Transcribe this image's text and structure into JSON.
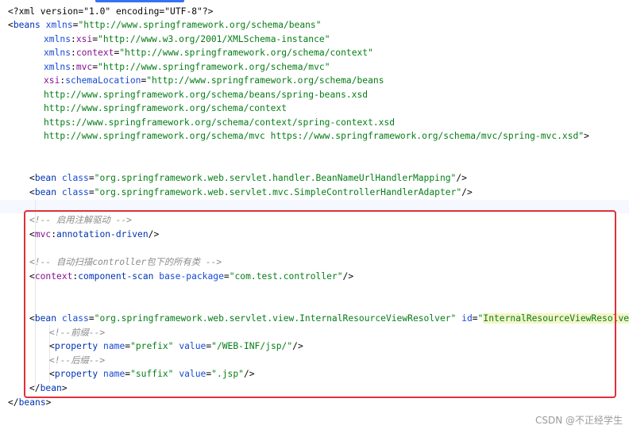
{
  "xml_decl": "<?xml version=\"1.0\" encoding=\"UTF-8\"?>",
  "lines": [
    {
      "parts": [
        [
          "punct",
          "<"
        ],
        [
          "tag",
          "beans"
        ],
        [
          "punct",
          " "
        ],
        [
          "attr",
          "xmlns"
        ],
        [
          "punct",
          "="
        ],
        [
          "val",
          "\"http://www.springframework.org/schema/beans\""
        ]
      ]
    },
    {
      "parts": [
        [
          "attr",
          "xmlns"
        ],
        [
          "punct",
          ":"
        ],
        [
          "ns",
          "xsi"
        ],
        [
          "punct",
          "="
        ],
        [
          "val",
          "\"http://www.w3.org/2001/XMLSchema-instance\""
        ]
      ]
    },
    {
      "parts": [
        [
          "attr",
          "xmlns"
        ],
        [
          "punct",
          ":"
        ],
        [
          "ns",
          "context"
        ],
        [
          "punct",
          "="
        ],
        [
          "val",
          "\"http://www.springframework.org/schema/context\""
        ]
      ]
    },
    {
      "parts": [
        [
          "attr",
          "xmlns"
        ],
        [
          "punct",
          ":"
        ],
        [
          "ns",
          "mvc"
        ],
        [
          "punct",
          "="
        ],
        [
          "val",
          "\"http://www.springframework.org/schema/mvc\""
        ]
      ]
    },
    {
      "parts": [
        [
          "ns",
          "xsi"
        ],
        [
          "punct",
          ":"
        ],
        [
          "attr",
          "schemaLocation"
        ],
        [
          "punct",
          "="
        ],
        [
          "val",
          "\"http://www.springframework.org/schema/beans"
        ]
      ]
    },
    {
      "parts": [
        [
          "val",
          "http://www.springframework.org/schema/beans/spring-beans.xsd"
        ]
      ]
    },
    {
      "parts": [
        [
          "val",
          "http://www.springframework.org/schema/context"
        ]
      ]
    },
    {
      "parts": [
        [
          "val",
          "https://www.springframework.org/schema/context/spring-context.xsd"
        ]
      ]
    },
    {
      "parts": [
        [
          "val",
          "http://www.springframework.org/schema/mvc https://www.springframework.org/schema/mvc/spring-mvc.xsd\""
        ],
        [
          "punct",
          ">"
        ]
      ]
    },
    {
      "parts": [
        [
          "punct",
          "<"
        ],
        [
          "tag",
          "bean"
        ],
        [
          "punct",
          " "
        ],
        [
          "attr",
          "class"
        ],
        [
          "punct",
          "="
        ],
        [
          "val",
          "\"org.springframework.web.servlet.handler.BeanNameUrlHandlerMapping\""
        ],
        [
          "punct",
          "/>"
        ]
      ]
    },
    {
      "parts": [
        [
          "punct",
          "<"
        ],
        [
          "tag",
          "bean"
        ],
        [
          "punct",
          " "
        ],
        [
          "attr",
          "class"
        ],
        [
          "punct",
          "="
        ],
        [
          "val",
          "\"org.springframework.web.servlet.mvc.SimpleControllerHandlerAdapter\""
        ],
        [
          "punct",
          "/>"
        ]
      ]
    },
    {
      "parts": [
        [
          "comment",
          "<!-- 启用注解驱动 -->"
        ]
      ]
    },
    {
      "parts": [
        [
          "punct",
          "<"
        ],
        [
          "ns",
          "mvc"
        ],
        [
          "punct",
          ":"
        ],
        [
          "tag",
          "annotation-driven"
        ],
        [
          "punct",
          "/>"
        ]
      ]
    },
    {
      "parts": [
        [
          "comment",
          "<!-- 自动扫描controller包下的所有类 -->"
        ]
      ]
    },
    {
      "parts": [
        [
          "punct",
          "<"
        ],
        [
          "ns",
          "context"
        ],
        [
          "punct",
          ":"
        ],
        [
          "tag",
          "component-scan"
        ],
        [
          "punct",
          " "
        ],
        [
          "attr",
          "base-package"
        ],
        [
          "punct",
          "="
        ],
        [
          "val",
          "\"com.test.controller\""
        ],
        [
          "punct",
          "/>"
        ]
      ]
    },
    {
      "parts": [
        [
          "punct",
          "<"
        ],
        [
          "tag",
          "bean"
        ],
        [
          "punct",
          " "
        ],
        [
          "attr",
          "class"
        ],
        [
          "punct",
          "="
        ],
        [
          "val",
          "\"org.springframework.web.servlet.view.InternalResourceViewResolver\""
        ],
        [
          "punct",
          " "
        ],
        [
          "attr",
          "id"
        ],
        [
          "punct",
          "="
        ],
        [
          "val",
          "\""
        ],
        [
          "hlval",
          "InternalResourceViewResolver"
        ],
        [
          "val",
          "\""
        ],
        [
          "punct",
          ">"
        ]
      ]
    },
    {
      "parts": [
        [
          "comment",
          "<!--前缀-->"
        ]
      ]
    },
    {
      "parts": [
        [
          "punct",
          "<"
        ],
        [
          "tag",
          "property"
        ],
        [
          "punct",
          " "
        ],
        [
          "attr",
          "name"
        ],
        [
          "punct",
          "="
        ],
        [
          "val",
          "\"prefix\""
        ],
        [
          "punct",
          " "
        ],
        [
          "attr",
          "value"
        ],
        [
          "punct",
          "="
        ],
        [
          "val",
          "\"/WEB-INF/jsp/\""
        ],
        [
          "punct",
          "/>"
        ]
      ]
    },
    {
      "parts": [
        [
          "comment",
          "<!--后缀-->"
        ]
      ]
    },
    {
      "parts": [
        [
          "punct",
          "<"
        ],
        [
          "tag",
          "property"
        ],
        [
          "punct",
          " "
        ],
        [
          "attr",
          "name"
        ],
        [
          "punct",
          "="
        ],
        [
          "val",
          "\"suffix\""
        ],
        [
          "punct",
          " "
        ],
        [
          "attr",
          "value"
        ],
        [
          "punct",
          "="
        ],
        [
          "val",
          "\".jsp\""
        ],
        [
          "punct",
          "/>"
        ]
      ]
    },
    {
      "parts": [
        [
          "punct",
          "</"
        ],
        [
          "tag",
          "bean"
        ],
        [
          "punct",
          ">"
        ]
      ]
    },
    {
      "parts": [
        [
          "punct",
          "</"
        ],
        [
          "tag",
          "beans"
        ],
        [
          "punct",
          ">"
        ]
      ]
    }
  ],
  "watermark": "CSDN @不正经学生"
}
